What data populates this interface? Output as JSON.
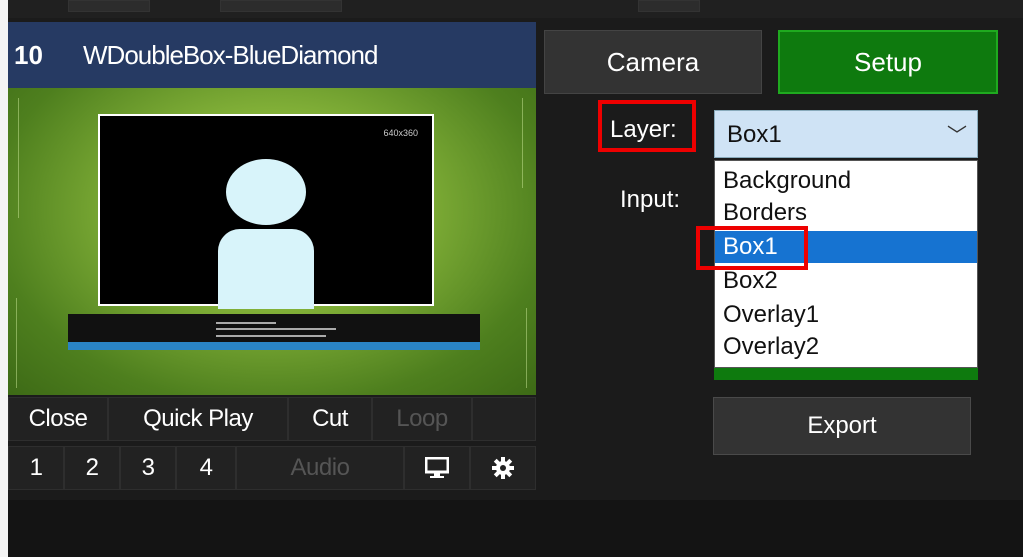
{
  "title": {
    "number": "10",
    "name": "WDoubleBox-BlueDiamond"
  },
  "preview": {
    "resolution": "640x360",
    "ticker_lines": [
      "",
      "",
      ""
    ]
  },
  "controls": {
    "row1": [
      {
        "label": "Close",
        "enabled": true
      },
      {
        "label": "Quick Play",
        "enabled": true
      },
      {
        "label": "Cut",
        "enabled": true
      },
      {
        "label": "Loop",
        "enabled": false
      },
      {
        "label": "",
        "enabled": true
      }
    ],
    "row2": [
      {
        "label": "1",
        "enabled": true
      },
      {
        "label": "2",
        "enabled": true
      },
      {
        "label": "3",
        "enabled": true
      },
      {
        "label": "4",
        "enabled": true
      },
      {
        "label": "Audio",
        "enabled": false
      }
    ],
    "icons": [
      "monitor-icon",
      "gear-icon"
    ]
  },
  "tabs": {
    "camera": "Camera",
    "setup": "Setup",
    "active": "setup"
  },
  "form": {
    "layer_label": "Layer:",
    "input_label": "Input:",
    "layer_value": "Box1",
    "options": [
      "Background",
      "Borders",
      "Box1",
      "Box2",
      "Overlay1",
      "Overlay2"
    ],
    "selected_option": "Box1"
  },
  "export_label": "Export",
  "colors": {
    "accent_green": "#0e7a0e",
    "selection_blue": "#1673d1",
    "highlight_red": "#e00000",
    "title_blue": "#263a63"
  }
}
